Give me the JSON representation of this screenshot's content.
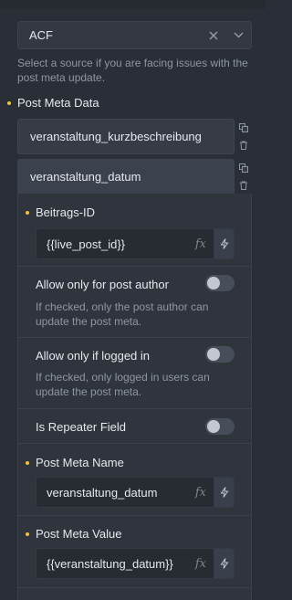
{
  "source": {
    "selected": "ACF",
    "help": "Select a source if you are facing issues with the post meta update."
  },
  "post_meta_data": {
    "label": "Post Meta Data",
    "items": [
      {
        "label": "veranstaltung_kurzbeschreibung"
      },
      {
        "label": "veranstaltung_datum"
      }
    ]
  },
  "item_fields": {
    "post_id": {
      "label": "Beitrags-ID",
      "value": "{{live_post_id}}"
    },
    "allow_author": {
      "label": "Allow only for post author",
      "help": "If checked, only the post author can update the post meta.",
      "checked": false
    },
    "allow_logged_in": {
      "label": "Allow only if logged in",
      "help": "If checked, only logged in users can update the post meta.",
      "checked": false
    },
    "is_repeater": {
      "label": "Is Repeater Field",
      "checked": false
    },
    "meta_name": {
      "label": "Post Meta Name",
      "value": "veranstaltung_datum"
    },
    "meta_value": {
      "label": "Post Meta Value",
      "value": "{{veranstaltung_datum}}"
    }
  },
  "icons": {
    "fx": "fx",
    "dynamic_data": "bolt-icon",
    "duplicate": "duplicate-icon",
    "delete": "trash-icon",
    "clear": "close-icon",
    "dropdown": "chevron-down-icon"
  },
  "colors": {
    "accent": "#f3c233"
  }
}
